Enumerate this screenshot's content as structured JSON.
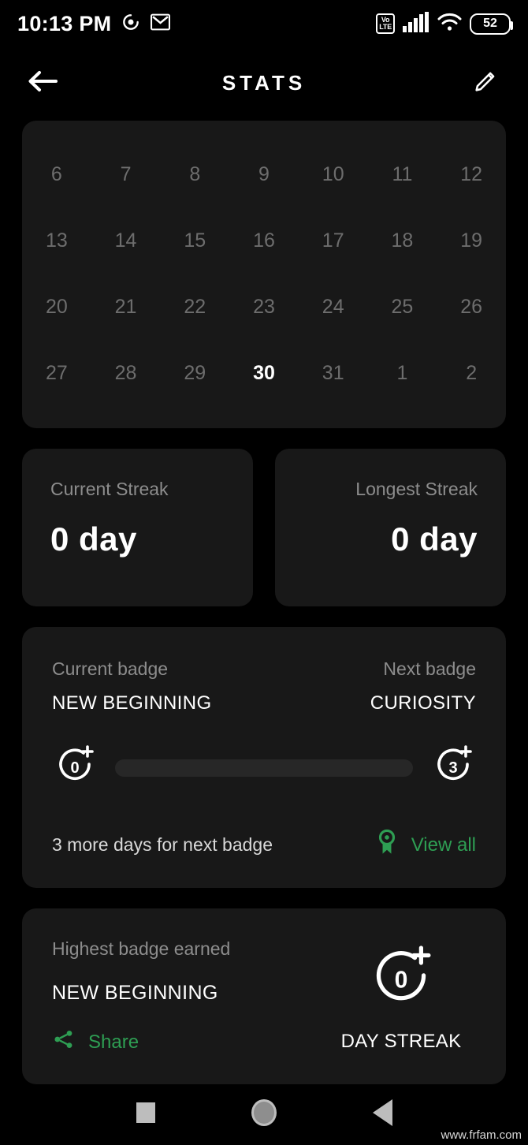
{
  "status_bar": {
    "time": "10:13 PM",
    "icons_left": [
      "dnd-icon",
      "gmail-icon"
    ],
    "volte_top": "Vo",
    "volte_bottom": "LTE",
    "battery_level": "52"
  },
  "header": {
    "back_icon": "back-arrow-icon",
    "title": "STATS",
    "edit_icon": "pencil-edit-icon"
  },
  "calendar": {
    "rows": [
      [
        {
          "day": "6",
          "today": false
        },
        {
          "day": "7",
          "today": false
        },
        {
          "day": "8",
          "today": false
        },
        {
          "day": "9",
          "today": false
        },
        {
          "day": "10",
          "today": false
        },
        {
          "day": "11",
          "today": false
        },
        {
          "day": "12",
          "today": false
        }
      ],
      [
        {
          "day": "13",
          "today": false
        },
        {
          "day": "14",
          "today": false
        },
        {
          "day": "15",
          "today": false
        },
        {
          "day": "16",
          "today": false
        },
        {
          "day": "17",
          "today": false
        },
        {
          "day": "18",
          "today": false
        },
        {
          "day": "19",
          "today": false
        }
      ],
      [
        {
          "day": "20",
          "today": false
        },
        {
          "day": "21",
          "today": false
        },
        {
          "day": "22",
          "today": false
        },
        {
          "day": "23",
          "today": false
        },
        {
          "day": "24",
          "today": false
        },
        {
          "day": "25",
          "today": false
        },
        {
          "day": "26",
          "today": false
        }
      ],
      [
        {
          "day": "27",
          "today": false
        },
        {
          "day": "28",
          "today": false
        },
        {
          "day": "29",
          "today": false
        },
        {
          "day": "30",
          "today": true
        },
        {
          "day": "31",
          "today": false
        },
        {
          "day": "1",
          "today": false
        },
        {
          "day": "2",
          "today": false
        }
      ]
    ]
  },
  "streaks": {
    "current": {
      "label": "Current Streak",
      "value": "0 day"
    },
    "longest": {
      "label": "Longest Streak",
      "value": "0 day"
    }
  },
  "badge_progress": {
    "current_label": "Current badge",
    "current_name": "NEW BEGINNING",
    "next_label": "Next badge",
    "next_name": "CURIOSITY",
    "current_days": "0",
    "next_days": "3",
    "progress_percent": 0,
    "footer_text": "3 more days for next badge",
    "view_all_label": "View all",
    "view_all_icon": "award-ribbon-icon",
    "accent_color": "#2e9e53"
  },
  "highest_badge": {
    "label": "Highest badge earned",
    "name": "NEW BEGINNING",
    "share_label": "Share",
    "share_icon": "share-nodes-icon",
    "streak_days": "0",
    "streak_caption": "DAY STREAK"
  },
  "nav_bar": {
    "recents": "recents-square-icon",
    "home": "home-circle-icon",
    "back": "back-triangle-icon"
  },
  "watermark": "www.frfam.com"
}
